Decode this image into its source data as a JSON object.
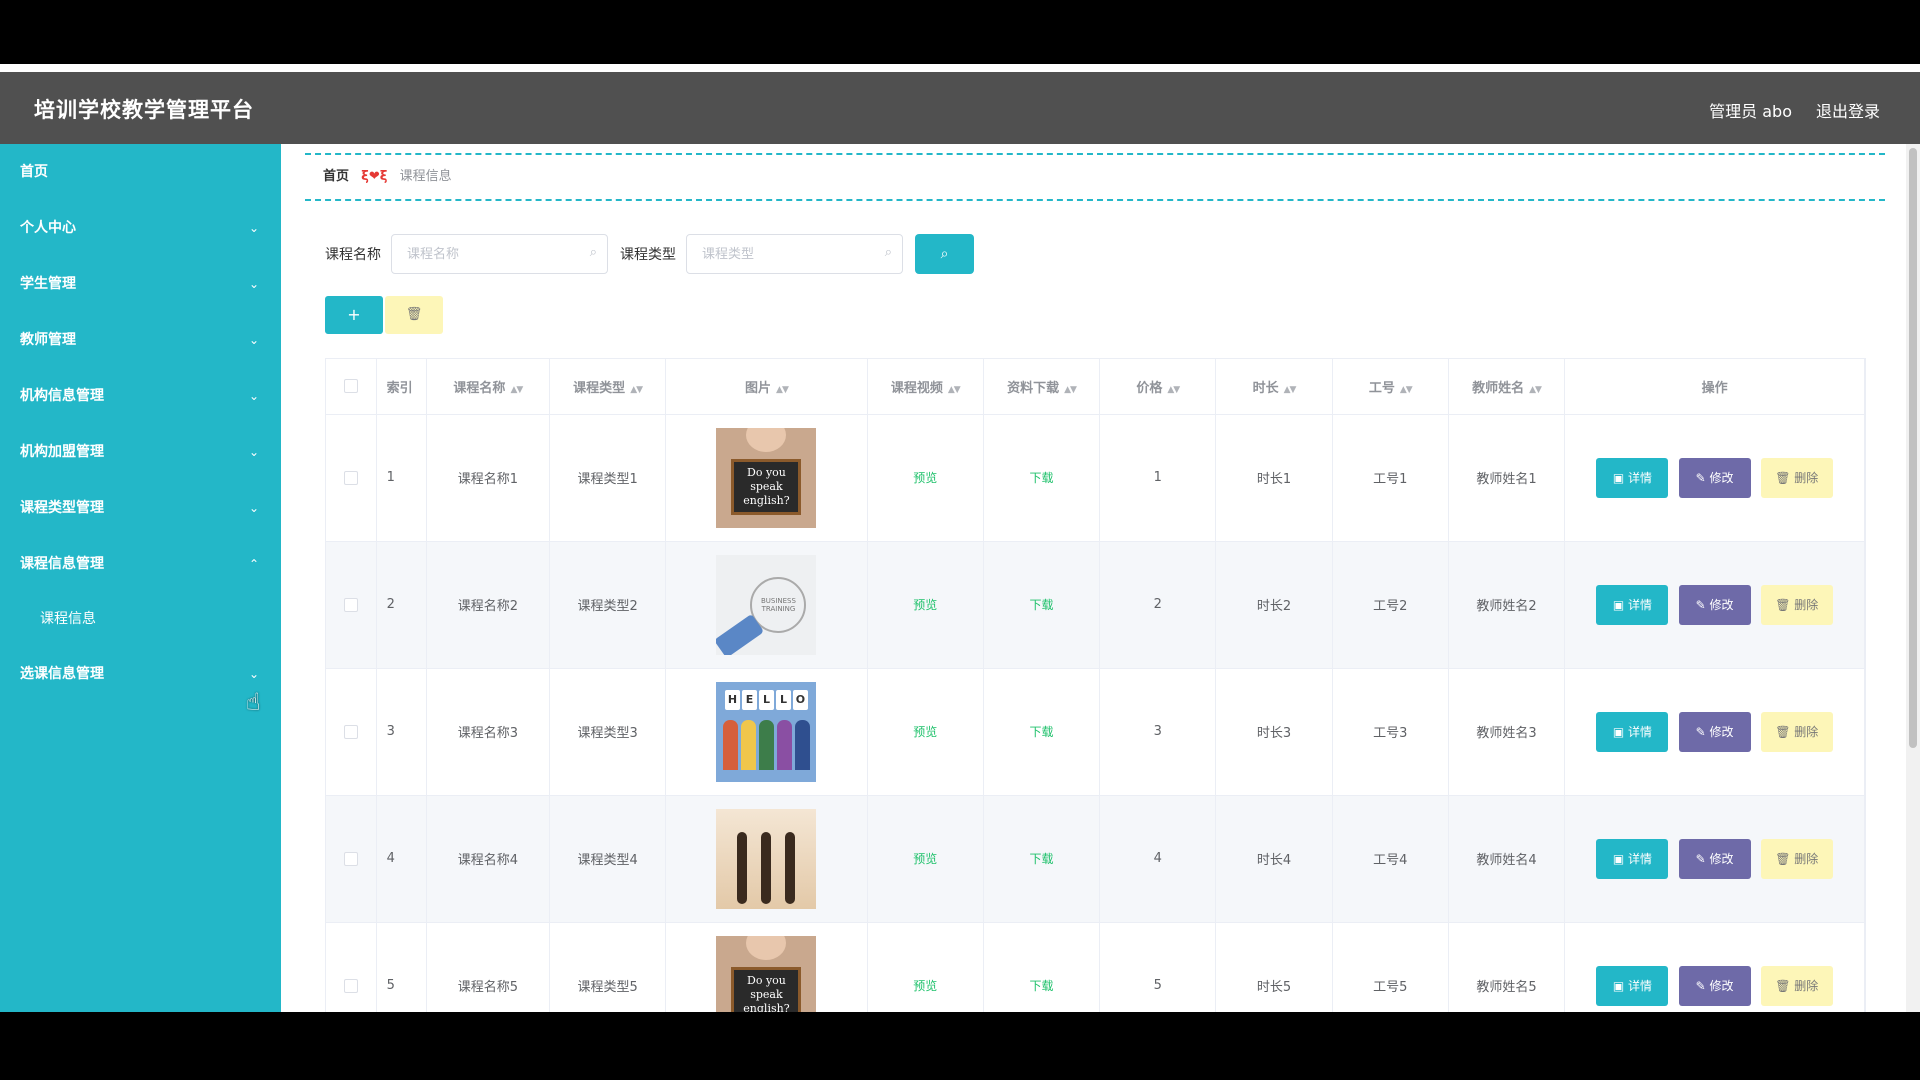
{
  "app": {
    "title": "培训学校教学管理平台",
    "user_label": "管理员 abo",
    "logout_label": "退出登录"
  },
  "sidebar": {
    "items": [
      {
        "label": "首页",
        "chevron": ""
      },
      {
        "label": "个人中心",
        "chevron": "⌄"
      },
      {
        "label": "学生管理",
        "chevron": "⌄"
      },
      {
        "label": "教师管理",
        "chevron": "⌄"
      },
      {
        "label": "机构信息管理",
        "chevron": "⌄"
      },
      {
        "label": "机构加盟管理",
        "chevron": "⌄"
      },
      {
        "label": "课程类型管理",
        "chevron": "⌄"
      },
      {
        "label": "课程信息管理",
        "chevron": "⌃"
      },
      {
        "label": "选课信息管理",
        "chevron": "⌄"
      }
    ],
    "sub_item": "课程信息"
  },
  "breadcrumb": {
    "home": "首页",
    "separator": "ξ❤ξ",
    "current": "课程信息"
  },
  "search": {
    "name_label": "课程名称",
    "name_placeholder": "课程名称",
    "type_label": "课程类型",
    "type_placeholder": "课程类型",
    "search_icon": "search-icon"
  },
  "toolbar": {
    "add_label": "+",
    "delete_icon": "🗑"
  },
  "table": {
    "headers": {
      "index": "索引",
      "course_name": "课程名称",
      "course_type": "课程类型",
      "image": "图片",
      "video": "课程视频",
      "download": "资料下载",
      "price": "价格",
      "duration": "时长",
      "staff_no": "工号",
      "teacher": "教师姓名",
      "actions": "操作"
    },
    "rows": [
      {
        "index": "1",
        "course_name": "课程名称1",
        "course_type": "课程类型1",
        "image": "Do you speak english?",
        "video": "预览",
        "download": "下载",
        "price": "1",
        "duration": "时长1",
        "staff_no": "工号1",
        "teacher": "教师姓名1"
      },
      {
        "index": "2",
        "course_name": "课程名称2",
        "course_type": "课程类型2",
        "image": "BUSINESS TRAINING",
        "video": "预览",
        "download": "下载",
        "price": "2",
        "duration": "时长2",
        "staff_no": "工号2",
        "teacher": "教师姓名2"
      },
      {
        "index": "3",
        "course_name": "课程名称3",
        "course_type": "课程类型3",
        "image": "HELLO",
        "video": "预览",
        "download": "下载",
        "price": "3",
        "duration": "时长3",
        "staff_no": "工号3",
        "teacher": "教师姓名3"
      },
      {
        "index": "4",
        "course_name": "课程名称4",
        "course_type": "课程类型4",
        "image": "",
        "video": "预览",
        "download": "下载",
        "price": "4",
        "duration": "时长4",
        "staff_no": "工号4",
        "teacher": "教师姓名4"
      },
      {
        "index": "5",
        "course_name": "课程名称5",
        "course_type": "课程类型5",
        "image": "Do you speak english?",
        "video": "预览",
        "download": "下载",
        "price": "5",
        "duration": "时长5",
        "staff_no": "工号5",
        "teacher": "教师姓名5"
      }
    ],
    "actions": {
      "detail": "详情",
      "edit": "修改",
      "delete": "删除",
      "detail_icon": "▣",
      "edit_icon": "✎",
      "delete_icon": "🗑"
    }
  },
  "colors": {
    "accent": "#23b7c8",
    "header": "#505050",
    "edit": "#6e6aa8",
    "delete": "#fdf6b8",
    "link": "#1fc16b"
  }
}
